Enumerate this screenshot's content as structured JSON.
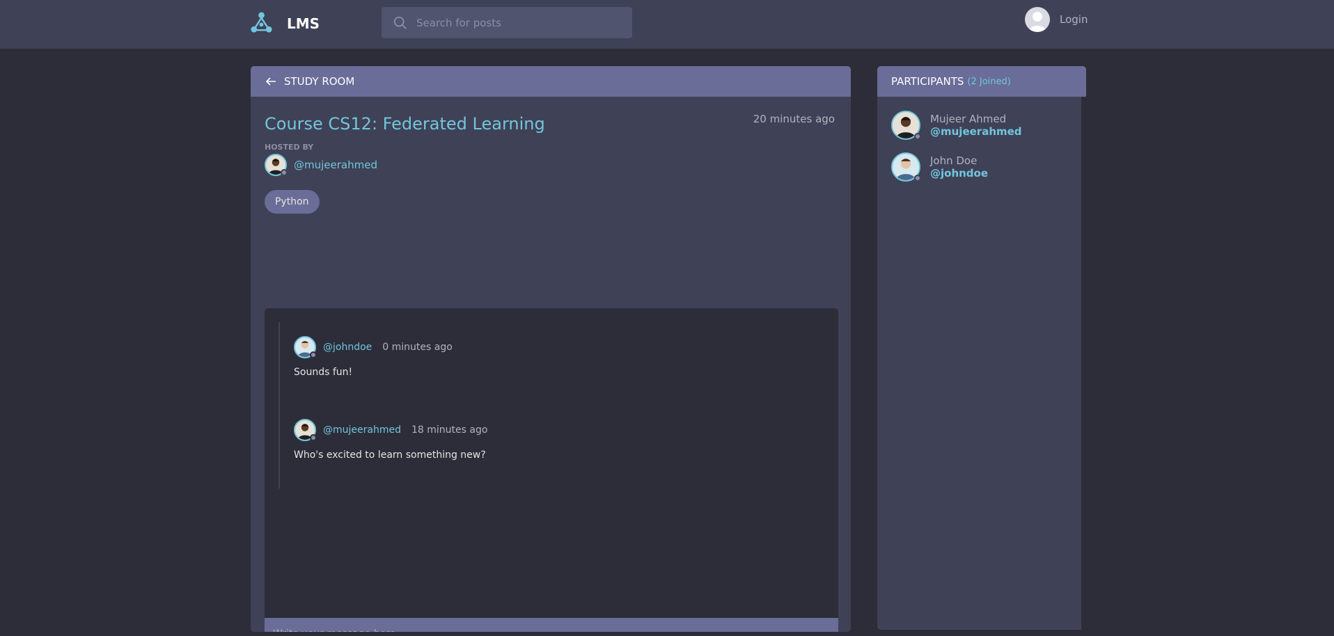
{
  "header": {
    "logo_text": "LMS",
    "search_placeholder": "Search for posts",
    "login_label": "Login"
  },
  "room": {
    "section_label": "STUDY ROOM",
    "title": "Course CS12: Federated Learning",
    "created": "20 minutes ago",
    "hosted_by_label": "HOSTED BY",
    "host": "@mujeerahmed",
    "topic": "Python"
  },
  "messages": [
    {
      "author": "@johndoe",
      "time": "0 minutes ago",
      "text": "Sounds fun!"
    },
    {
      "author": "@mujeerahmed",
      "time": "18 minutes ago",
      "text": "Who's excited to learn something new?"
    }
  ],
  "composer": {
    "placeholder": "Write your message here..."
  },
  "participants": {
    "title": "PARTICIPANTS",
    "count": "(2 Joined)",
    "items": [
      {
        "name": "Mujeer Ahmed",
        "handle": "@mujeerahmed"
      },
      {
        "name": "John Doe",
        "handle": "@johndoe"
      }
    ]
  },
  "colors": {
    "background": "#2d2d39",
    "panel": "#3f4156",
    "accent": "#696d97",
    "link": "#71c6dd"
  }
}
